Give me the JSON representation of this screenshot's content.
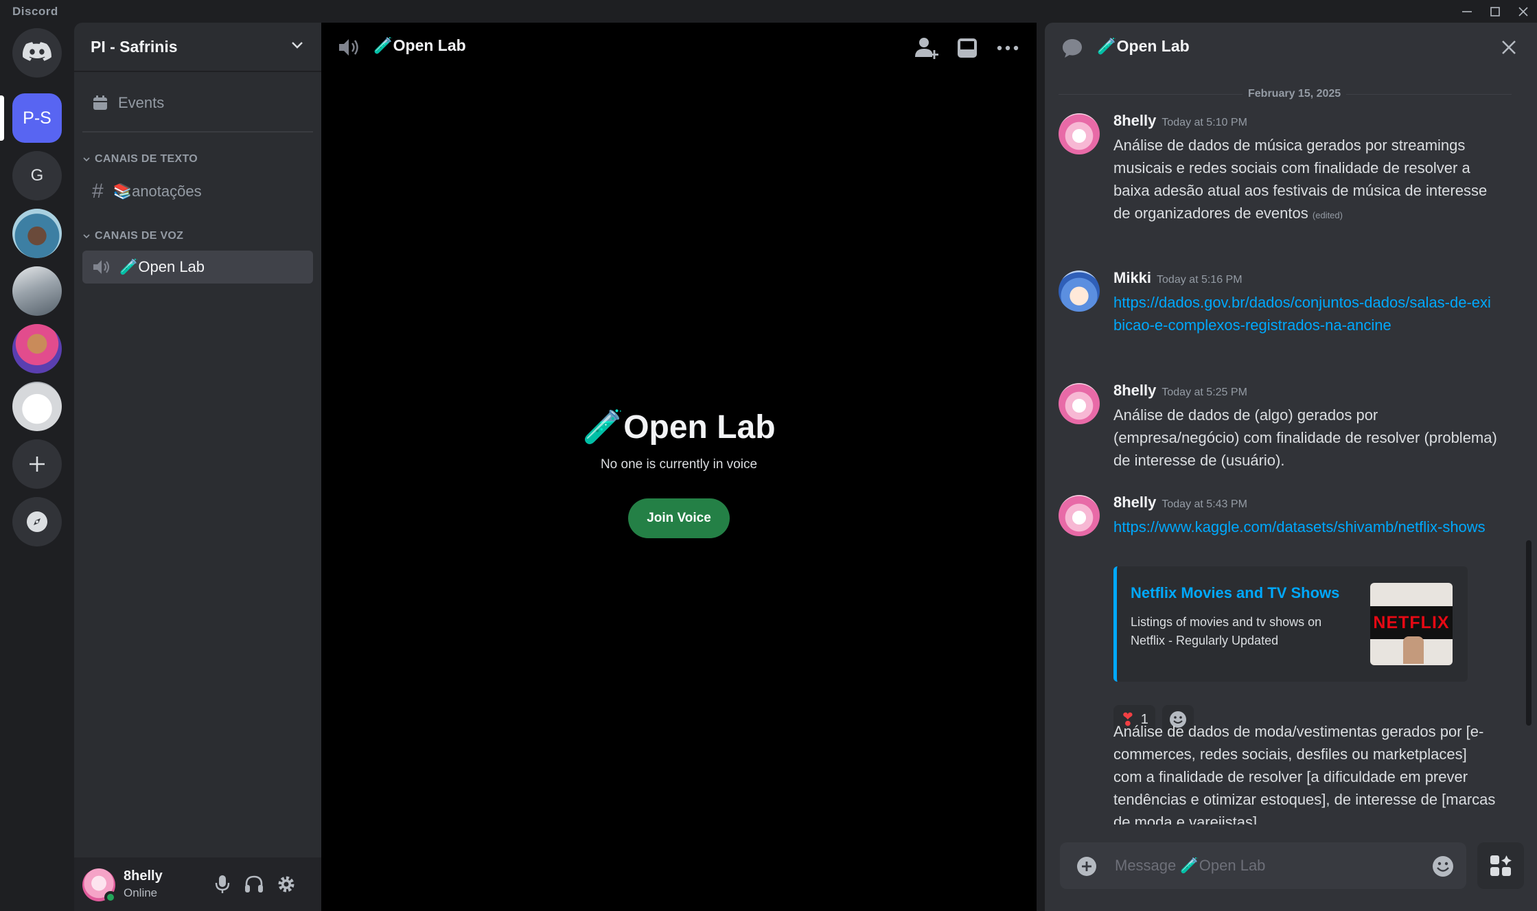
{
  "app": {
    "title": "Discord"
  },
  "rail": {
    "active_server_label": "P-S",
    "server_g_label": "G"
  },
  "sidebar": {
    "server_name": "PI - Safrinis",
    "events_label": "Events",
    "text_category": "CANAIS DE TEXTO",
    "text_channel": "📚anotações",
    "voice_category": "CANAIS DE VOZ",
    "voice_channel": "🧪Open Lab"
  },
  "user": {
    "name": "8helly",
    "status": "Online"
  },
  "voice": {
    "header_title": "🧪Open Lab",
    "big_title": "🧪Open Lab",
    "subtitle": "No one is currently in voice",
    "join_label": "Join Voice"
  },
  "chat": {
    "header_title": "🧪Open Lab",
    "date_separator": "February 15, 2025",
    "messages": [
      {
        "author": "8helly",
        "time": "Today at 5:10 PM",
        "text": "Análise de dados de música gerados por streamings musicais e redes sociais com finalidade de resolver a baixa adesão atual aos festivais de música de interesse de organizadores de eventos",
        "edited": "(edited)"
      },
      {
        "author": "Mikki",
        "time": "Today at 5:16 PM",
        "link": "https://dados.gov.br/dados/conjuntos-dados/salas-de-exibicao-e-complexos-registrados-na-ancine"
      },
      {
        "author": "8helly",
        "time": "Today at 5:25 PM",
        "text": "Análise de dados de (algo) gerados por (empresa/negócio) com finalidade de resolver (problema) de interesse de (usuário)."
      },
      {
        "author": "8helly",
        "time": "Today at 5:43 PM",
        "link": "https://www.kaggle.com/datasets/shivamb/netflix-shows"
      }
    ],
    "embed": {
      "title": "Netflix Movies and TV Shows",
      "description": "Listings of movies and tv shows on Netflix - Regularly Updated",
      "thumb_text": "NETFLIX"
    },
    "reaction": {
      "emoji": "❣",
      "count": "1"
    },
    "followup_text": "Análise de dados de moda/vestimentas gerados por [e-commerces, redes sociais, desfiles ou marketplaces] com a finalidade de resolver [a dificuldade em prever tendências e otimizar estoques], de interesse de [marcas de moda e varejistas]",
    "composer_placeholder": "Message 🧪Open Lab"
  },
  "colors": {
    "accent": "#5865f2",
    "join_green": "#248046",
    "link": "#00a8fc",
    "online": "#23a55a"
  }
}
